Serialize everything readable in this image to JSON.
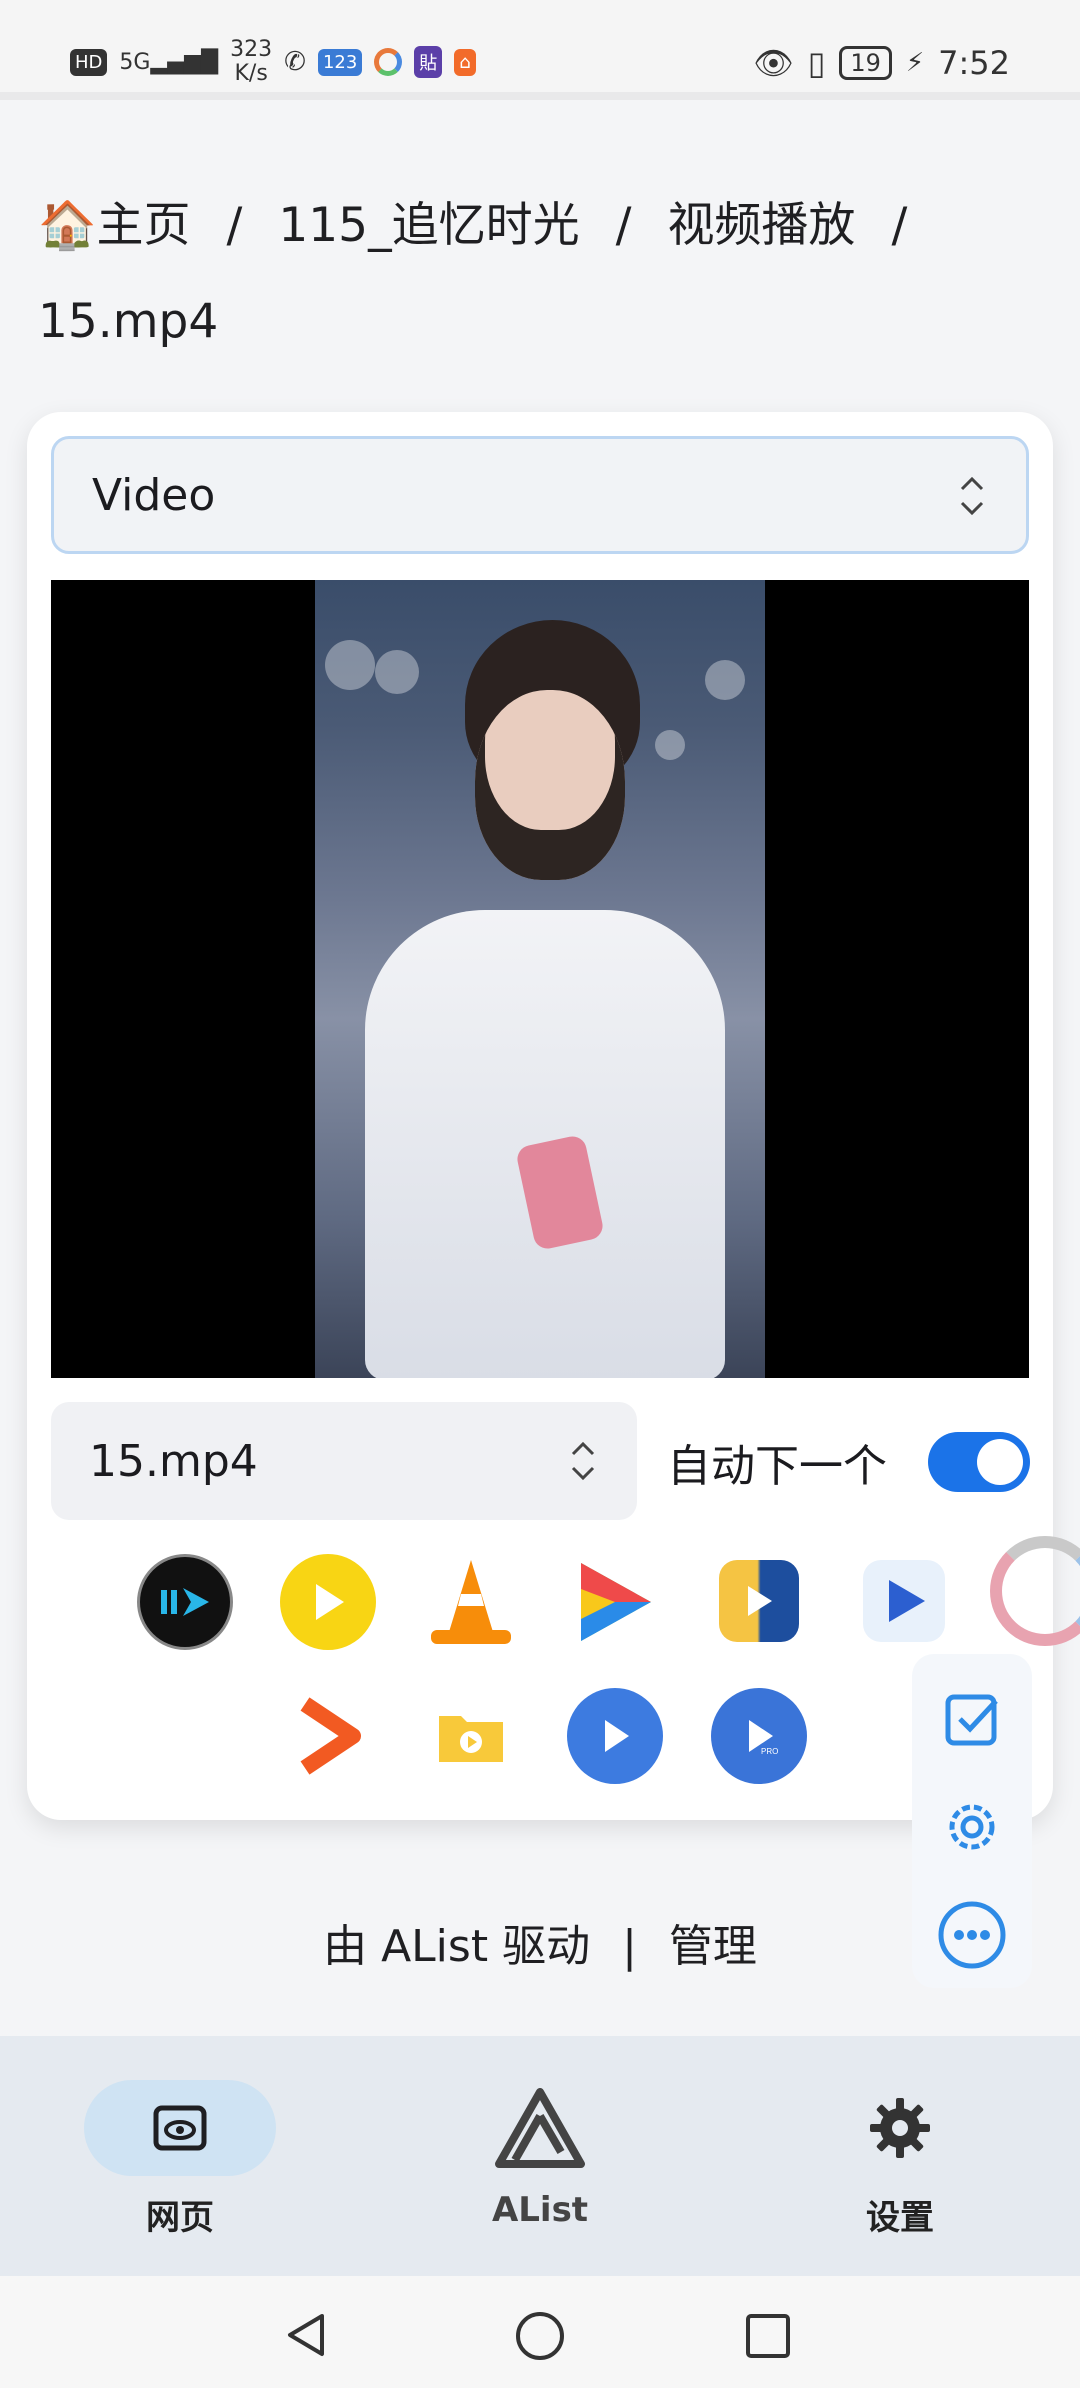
{
  "statusbar": {
    "net_speed_value": "323",
    "net_speed_unit": "K/s",
    "time": "7:52",
    "battery": "19",
    "hd_label": "HD",
    "network_label": "5G"
  },
  "breadcrumb": {
    "home": "主页",
    "home_icon": "🏠",
    "item1": "115_追忆时光",
    "item2": "视频播放",
    "current": "15.mp4",
    "separator": "/"
  },
  "player": {
    "type_select_value": "Video",
    "file_select_value": "15.mp4",
    "autonext_label": "自动下一个",
    "autonext_enabled": true,
    "external_players": [
      "iina-icon",
      "potplayer-icon",
      "vlc-icon",
      "infuse-icon",
      "fileball-icon",
      "nplayer-icon",
      "senplayer-icon",
      "omniplayer-icon",
      "figplayer-icon",
      "mxplayer-pro-icon"
    ]
  },
  "footer": {
    "powered_by": "由 AList 驱动",
    "separator": "|",
    "manage": "管理"
  },
  "bottom_nav": {
    "items": [
      {
        "label": "网页",
        "icon": "webview-eye-icon",
        "active": true
      },
      {
        "label": "AList",
        "icon": "alist-logo-icon",
        "active": false
      },
      {
        "label": "设置",
        "icon": "gear-icon",
        "active": false
      }
    ]
  },
  "colors": {
    "accent": "#1b73e8",
    "card": "#ffffff",
    "background": "#f4f5f7",
    "nav_background": "#e5eaf0",
    "nav_active_pill": "#cfe3f3"
  }
}
